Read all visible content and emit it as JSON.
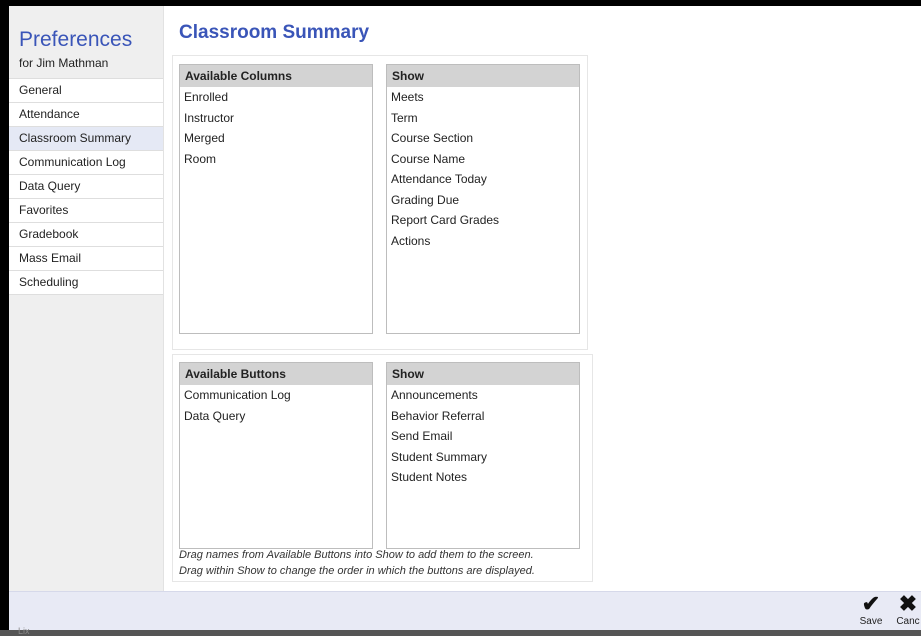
{
  "sidebar": {
    "title": "Preferences",
    "subtitle": "for Jim Mathman",
    "items": [
      {
        "label": "General",
        "active": false
      },
      {
        "label": "Attendance",
        "active": false
      },
      {
        "label": "Classroom Summary",
        "active": true
      },
      {
        "label": "Communication Log",
        "active": false
      },
      {
        "label": "Data Query",
        "active": false
      },
      {
        "label": "Favorites",
        "active": false
      },
      {
        "label": "Gradebook",
        "active": false
      },
      {
        "label": "Mass Email",
        "active": false
      },
      {
        "label": "Scheduling",
        "active": false
      }
    ]
  },
  "main": {
    "title": "Classroom Summary",
    "columns": {
      "available_header": "Available Columns",
      "available": [
        "Enrolled",
        "Instructor",
        "Merged",
        "Room"
      ],
      "show_header": "Show",
      "show": [
        "Meets",
        "Term",
        "Course Section",
        "Course Name",
        "Attendance Today",
        "Grading Due",
        "Report Card Grades",
        "Actions"
      ]
    },
    "buttons": {
      "available_header": "Available Buttons",
      "available": [
        "Communication Log",
        "Data Query"
      ],
      "show_header": "Show",
      "show": [
        "Announcements",
        "Behavior Referral",
        "Send Email",
        "Student Summary",
        "Student Notes"
      ]
    },
    "instructions": [
      "Drag names from Available Buttons into Show to add them to the screen.",
      "Drag within Show to change the order in which the buttons are displayed."
    ]
  },
  "footer": {
    "save_label": "Save",
    "cancel_label": "Canc"
  },
  "corner_text": "Lix",
  "colors": {
    "accent": "#3a55b8",
    "footer_bg": "#e8eaf5",
    "header_bg": "#d3d3d3"
  }
}
